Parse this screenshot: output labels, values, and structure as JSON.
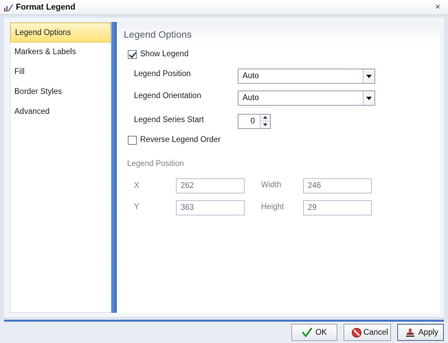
{
  "window": {
    "title": "Format Legend",
    "close_symbol": "×"
  },
  "sidebar": {
    "items": [
      {
        "label": "Legend Options",
        "active": true
      },
      {
        "label": "Markers & Labels",
        "active": false
      },
      {
        "label": "Fill",
        "active": false
      },
      {
        "label": "Border Styles",
        "active": false
      },
      {
        "label": "Advanced",
        "active": false
      }
    ]
  },
  "main": {
    "section_title": "Legend Options",
    "show_legend": {
      "label": "Show Legend",
      "checked": true
    },
    "legend_position": {
      "label": "Legend Position",
      "value": "Auto"
    },
    "legend_orientation": {
      "label": "Legend Orientation",
      "value": "Auto"
    },
    "legend_series_start": {
      "label": "Legend Series Start",
      "value": "0"
    },
    "reverse_order": {
      "label": "Reverse Legend Order",
      "checked": false
    },
    "position_group": {
      "label": "Legend Position",
      "x_label": "X",
      "x_value": "262",
      "y_label": "Y",
      "y_value": "363",
      "width_label": "Width",
      "width_value": "246",
      "height_label": "Height",
      "height_value": "29"
    }
  },
  "footer": {
    "ok_label": "OK",
    "cancel_label": "Cancel",
    "apply_label": "Apply"
  },
  "icons": {
    "title": "chart-edit-icon",
    "ok": "checkmark-icon",
    "cancel": "cancel-icon",
    "apply": "apply-stamp-icon"
  },
  "colors": {
    "accent": "#3b6fc4",
    "active_nav": "#ffe27a"
  }
}
